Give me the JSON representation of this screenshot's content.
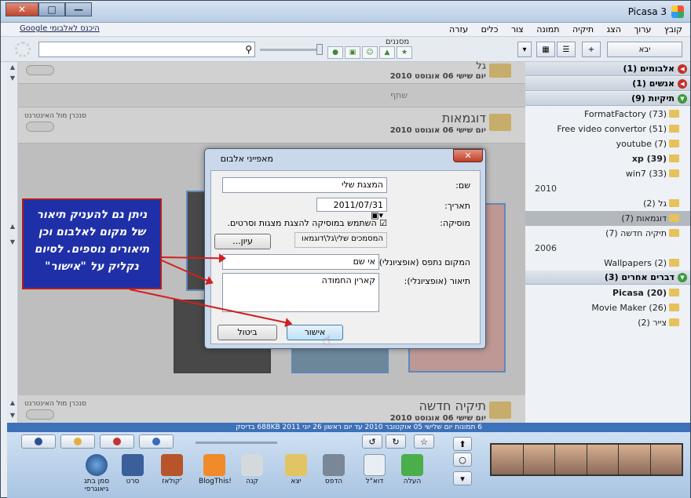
{
  "window": {
    "title": "Picasa 3",
    "close_glyph": "✕",
    "max_glyph": "□",
    "min_glyph": "—"
  },
  "menu": {
    "items": [
      "קובץ",
      "ערוך",
      "הצג",
      "תיקיה",
      "תמונה",
      "צור",
      "כלים",
      "עזרה"
    ],
    "google_link": "Google היכנס לאלבומי"
  },
  "toolbar": {
    "import_label": "יבא",
    "filters_label": "מסננים"
  },
  "sidebar": {
    "sections": [
      {
        "label": "אלבומים (1)"
      },
      {
        "label": "אנשים (1)"
      },
      {
        "label": "תיקיות (9)"
      }
    ],
    "folders": [
      {
        "label": "FormatFactory (73)"
      },
      {
        "label": "Free video convertor (51)"
      },
      {
        "label": "youtube (7)"
      },
      {
        "label": "xp (39)"
      },
      {
        "label": "win7 (33)"
      }
    ],
    "year_2010": "2010",
    "folders_2010": [
      {
        "label": "גל (2)"
      },
      {
        "label": "דוגמאות (7)"
      },
      {
        "label": "תיקיה חדשה (7)"
      }
    ],
    "year_2006": "2006",
    "folders_2006": [
      {
        "label": "Wallpapers (2)"
      }
    ],
    "other_section": "דברים אחרים (3)",
    "other_folders": [
      {
        "label": "Picasa (20)"
      },
      {
        "label": "Movie Maker (26)"
      },
      {
        "label": "צייר (2)"
      }
    ]
  },
  "albums": [
    {
      "name": "גל",
      "date": "יום שישי 06 אוגוסט 2010"
    },
    {
      "name": "דוגמאות",
      "date": "יום שישי 06 אוגוסט 2010",
      "sync": "סנכרן מול האינטרנט",
      "share": "שתף"
    },
    {
      "name": "תיקיה חדשה",
      "date": "יום שישי 06 אוגוסט 2010",
      "sync": "סנכרן מול האינטרנט"
    }
  ],
  "status": {
    "text": "6 תמונות    יום שלישי 05 אוקטובר 2010 עד יום ראשון 26 יוני 2011    688KB בדיסק"
  },
  "tray": {
    "tools": [
      "העלה",
      "דוא\"ל",
      "הדפס",
      "יצא",
      "קנה",
      "BlogThis!",
      "קולאז'",
      "סרט",
      "סמן בתג גיאוגרפי"
    ]
  },
  "dialog": {
    "title": "מאפייני אלבום",
    "name_label": "שם:",
    "name_value": "המצגת שלי",
    "date_label": "תאריך:",
    "date_value": "2011/07/31",
    "music_label": "מוסיקה:",
    "music_checkbox": "השתמש במוסיקה להצגת מצגות וסרטים.",
    "path_value": "המסמכים שלי\\גל\\דוגמאו",
    "browse_label": "עיון...",
    "location_label": "המקום נתפס (אופציונלי):",
    "location_value": "אי שם",
    "desc_label": "תיאור (אופציונלי):",
    "desc_value": "קארין החמודה",
    "ok_label": "אישור",
    "cancel_label": "ביטול",
    "close_glyph": "✕"
  },
  "note": {
    "text": "ניתן גם להעניק תיאור של מקום לאלבום וכן תיאורים נוספים. לסיום נקליק על \"אישור\""
  },
  "colors": {
    "status_bar": "#3d71b9",
    "note_bg": "#1f2fa8",
    "arrow": "#d21f1f",
    "section_arrow": "#c2302a"
  }
}
